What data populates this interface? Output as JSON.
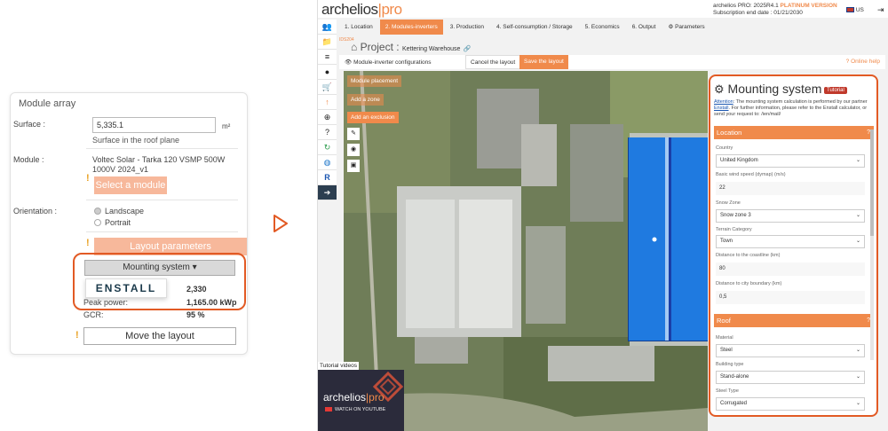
{
  "left_panel": {
    "title": "Module array",
    "surface_label": "Surface :",
    "surface_value": "5,335.1",
    "surface_unit": "m²",
    "surface_note": "Surface in the roof plane",
    "module_label": "Module :",
    "module_name": "Voltec Solar - Tarka 120 VSMP 500W 1000V 2024_v1",
    "select_module_btn": "Select a module",
    "orientation_label": "Orientation :",
    "orientation_options": [
      "Landscape",
      "Portrait"
    ],
    "layout_params_btn": "Layout parameters",
    "mounting_system_btn": "Mounting system",
    "dropdown_caret": "▾",
    "enstall_option": "ENSTALL",
    "modules_count": "2,330",
    "peak_power_label": "Peak power:",
    "peak_power_value": "1,165.00 kWp",
    "gcr_label": "GCR:",
    "gcr_value": "95 %",
    "move_layout_btn": "Move the layout",
    "warn_mark": "!"
  },
  "app": {
    "logo_main": "archelios",
    "logo_pro": "pro",
    "version_prefix": "archelios PRO: 2025R4.1",
    "version_plan": "PLATINUM VERSION",
    "subscription": "Subscription end date : 01/21/2030",
    "language": "US",
    "tabs": [
      {
        "label": "1. Location",
        "active": false
      },
      {
        "label": "2. Modules-inverters",
        "active": true
      },
      {
        "label": "3. Production",
        "active": false
      },
      {
        "label": "4. Self-consumption / Storage",
        "active": false
      },
      {
        "label": "5. Economics",
        "active": false
      },
      {
        "label": "6. Output",
        "active": false
      },
      {
        "label": "⚙ Parameters",
        "active": false
      }
    ],
    "breadcrumb": "IDS204",
    "project_prefix": "Project :",
    "project_name": "Kettering Warehouse",
    "config_label": "Module-inverter configurations",
    "cancel_layout": "Cancel the layout",
    "save_layout": "Save the layout",
    "online_help": "Online help",
    "map_buttons": [
      "Module placement",
      "Add a zone",
      "Add an exclusion"
    ],
    "tutorial_videos": "Tutorial videos",
    "video_logo_main": "archelios",
    "video_logo_pro": "pro",
    "video_watch": "WATCH ON YOUTUBE"
  },
  "mounting_panel": {
    "title": "Mounting system",
    "tutorial_badge": "Tutorial",
    "attention_word": "Attention",
    "attention_text": ": The mounting system calculation is performed by our partner",
    "partner_link": "Enstall",
    "attention_text2": ". For further information, please refer to the Enstall calculator, or send your request to: /ien/mail/",
    "location_section": "Location",
    "roof_section": "Roof",
    "help_mark": "?",
    "fields": {
      "country_label": "Country",
      "country_value": "United Kingdom",
      "wind_label": "Basic wind speed (dymap) (m/s)",
      "wind_value": "22",
      "snow_label": "Snow Zone",
      "snow_value": "Snow zone 3",
      "terrain_label": "Terrain Category",
      "terrain_value": "Town",
      "coast_label": "Distance to the coastline (km)",
      "coast_value": "80",
      "city_label": "Distance to city boundary (km)",
      "city_value": "0,5",
      "material_label": "Material",
      "material_value": "Steel",
      "building_label": "Building type",
      "building_value": "Stand-alone",
      "steel_label": "Steel Type",
      "steel_value": "Corrugated"
    }
  }
}
